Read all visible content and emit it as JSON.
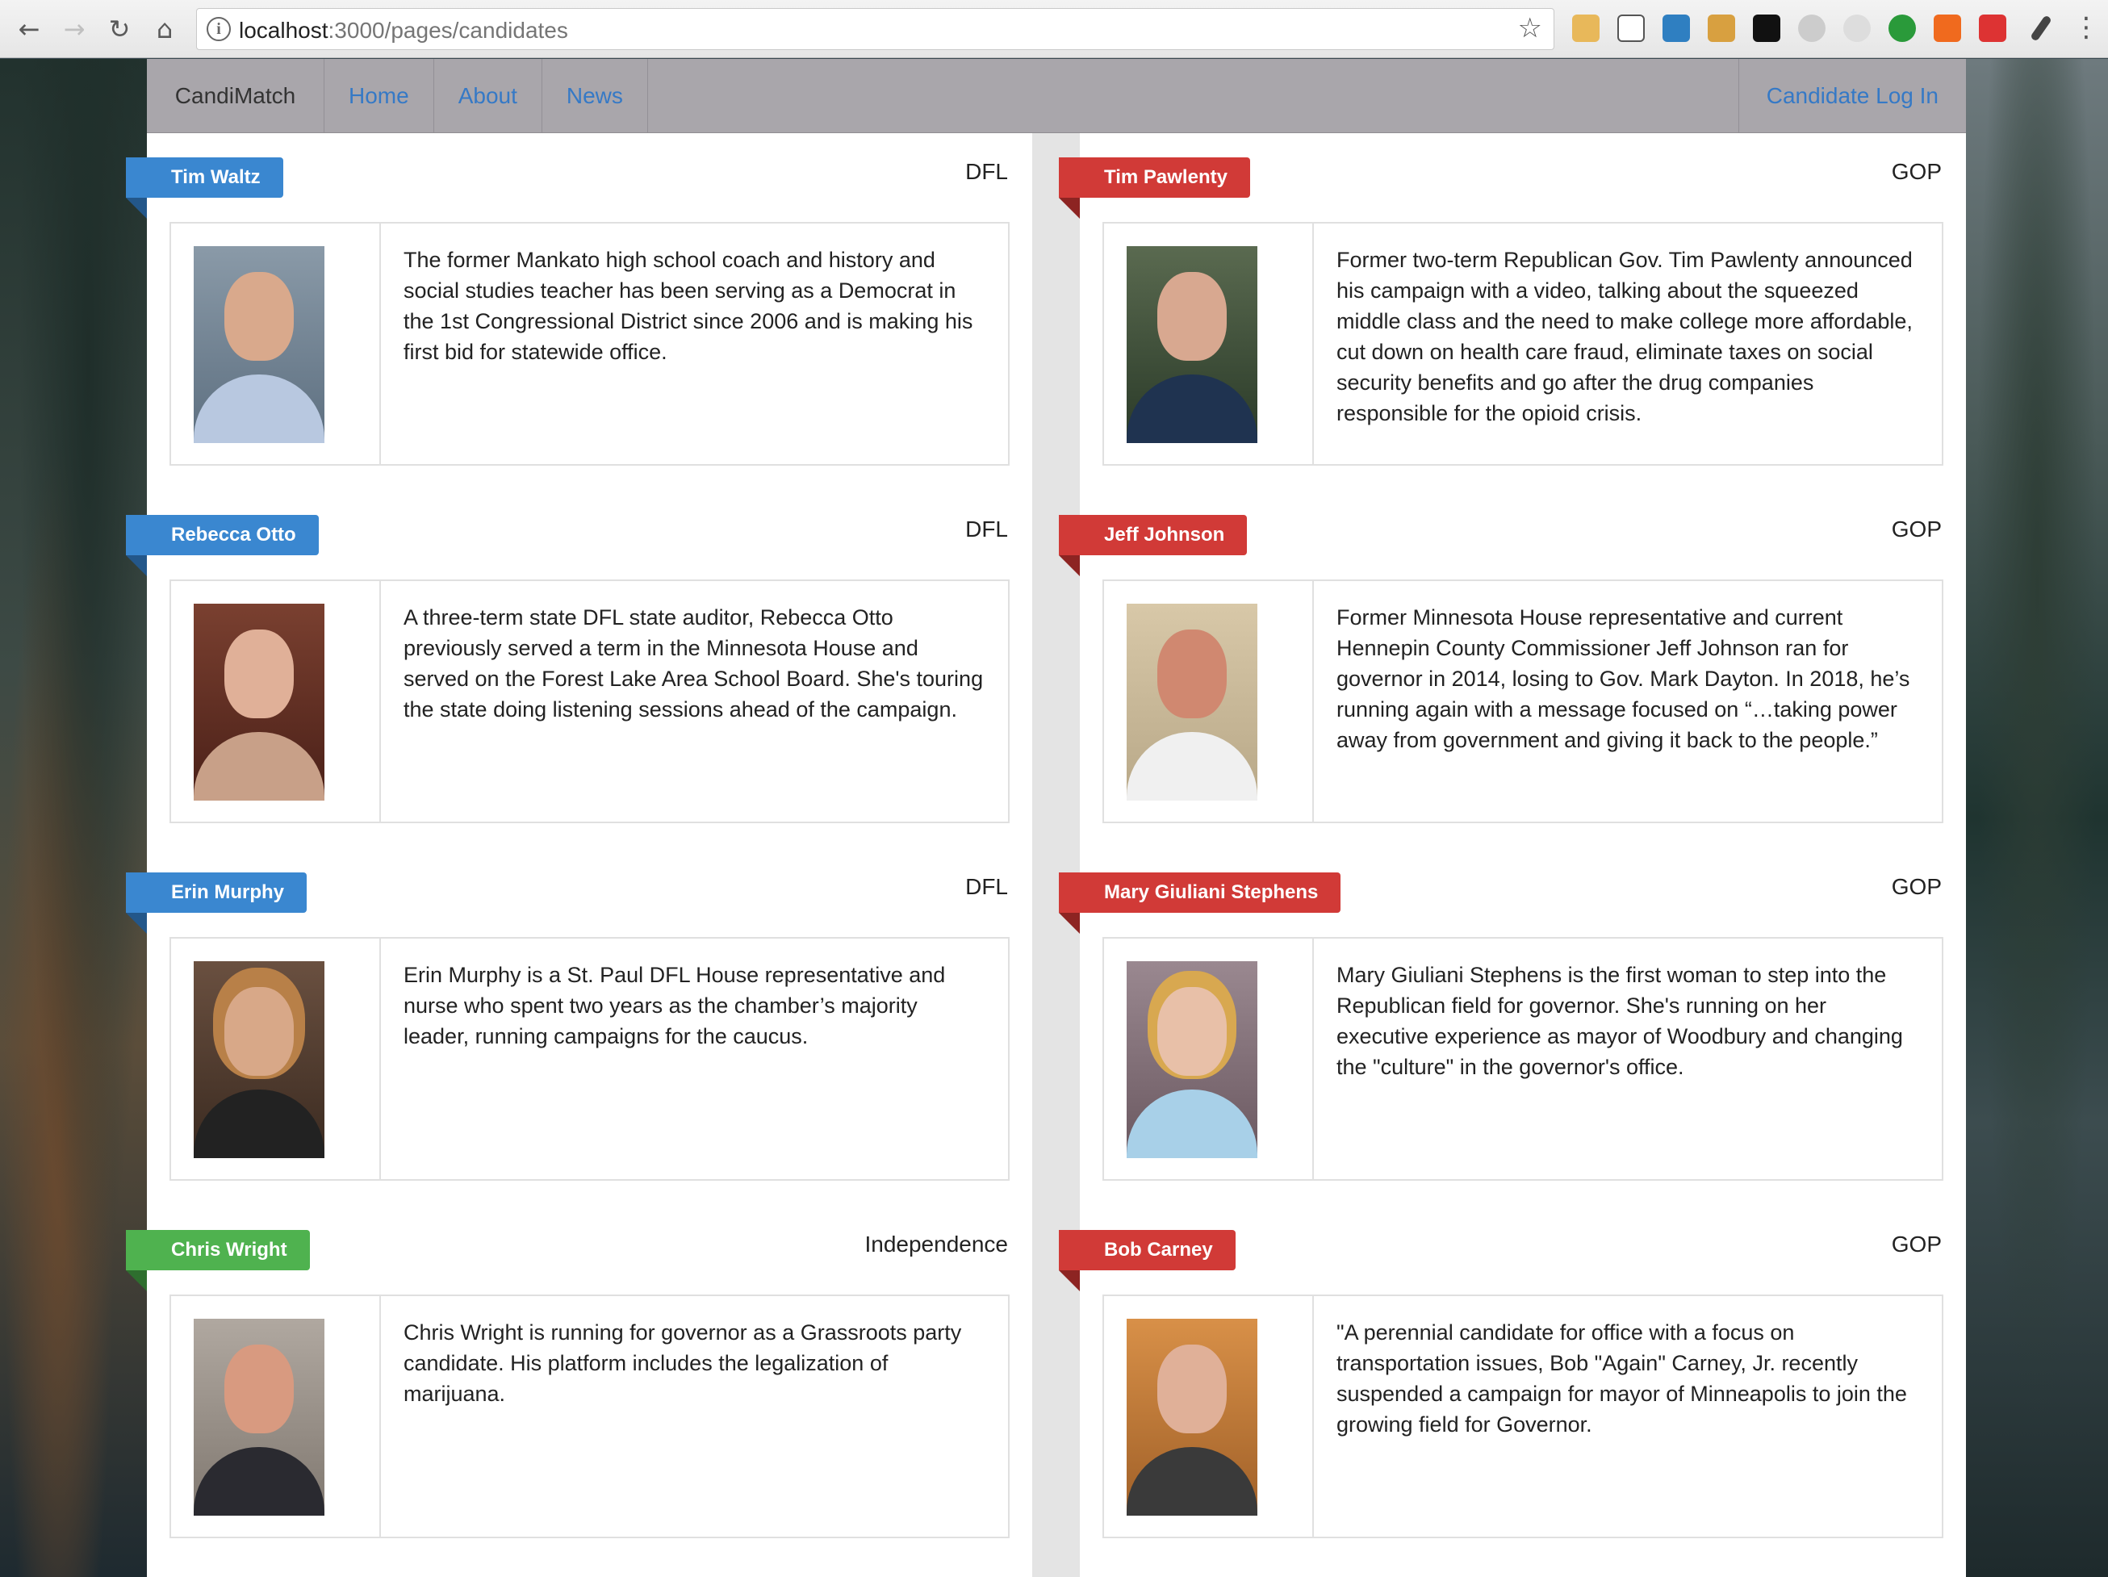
{
  "browser": {
    "url_host": "localhost",
    "url_path": ":3000/pages/candidates"
  },
  "nav": {
    "brand": "CandiMatch",
    "links": [
      "Home",
      "About",
      "News"
    ],
    "login": "Candidate Log In"
  },
  "colors": {
    "DFL": "#3a87d0",
    "GOP": "#d13a37",
    "Independence": "#4fb24f",
    "link": "#3579c6"
  },
  "left": [
    {
      "name": "Tim Waltz",
      "party": "DFL",
      "bio": "The former Mankato high school coach and history and social studies teacher has been serving as a Democrat in the 1st Congressional District since 2006 and is making his first bid for statewide office."
    },
    {
      "name": "Rebecca Otto",
      "party": "DFL",
      "bio": "A three-term state DFL state auditor, Rebecca Otto previously served a term in the Minnesota House and served on the Forest Lake Area School Board. She's touring the state doing listening sessions ahead of the campaign."
    },
    {
      "name": "Erin Murphy",
      "party": "DFL",
      "bio": "Erin Murphy is a St. Paul DFL House representative and nurse who spent two years as the chamber’s majority leader, running campaigns for the caucus."
    },
    {
      "name": "Chris Wright",
      "party": "Independence",
      "bio": "Chris Wright is running for governor as a Grassroots party candidate. His platform includes the legalization of marijuana."
    }
  ],
  "right": [
    {
      "name": "Tim Pawlenty",
      "party": "GOP",
      "bio": "Former two-term Republican Gov. Tim Pawlenty announced his campaign with a video, talking about the squeezed middle class and the need to make college more affordable, cut down on health care fraud, eliminate taxes on social security benefits and go after the drug companies responsible for the opioid crisis."
    },
    {
      "name": "Jeff Johnson",
      "party": "GOP",
      "bio": "Former Minnesota House representative and current Hennepin County Commissioner Jeff Johnson ran for governor in 2014, losing to Gov. Mark Dayton. In 2018, he’s running again with a message focused on “…taking power away from government and giving it back to the people.”"
    },
    {
      "name": "Mary Giuliani Stephens",
      "party": "GOP",
      "bio": "Mary Giuliani Stephens is the first woman to step into the Republican field for governor. She's running on her executive experience as mayor of Woodbury and changing the \"culture\" in the governor's office."
    },
    {
      "name": "Bob Carney",
      "party": "GOP",
      "bio": "\"A perennial candidate for office with a focus on transportation issues, Bob \"Again\" Carney, Jr. recently suspended a campaign for mayor of Minneapolis to join the growing field for Governor."
    }
  ]
}
